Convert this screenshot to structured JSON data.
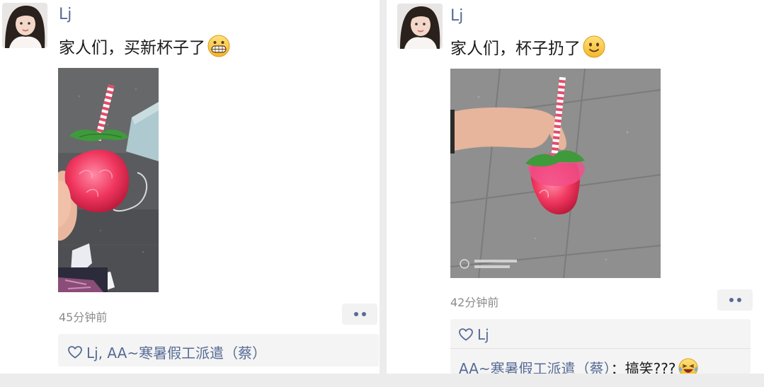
{
  "posts": [
    {
      "author": "Lj",
      "text": "家人们，买新杯子了",
      "emoji_name": "grinning-face-emoji",
      "time": "45分钟前",
      "likes": "Lj, AA~寒暑假工派遣（蔡）"
    },
    {
      "author": "Lj",
      "text": "家人们，杯子扔了",
      "emoji_name": "slight-smile-emoji",
      "time": "42分钟前",
      "likes": "Lj",
      "comment": {
        "author": "AA~寒暑假工派遣（蔡）",
        "separator": "：",
        "text": "搞笑???",
        "emoji_name": "laughing-tears-emoji"
      }
    }
  ],
  "colors": {
    "link": "#576b95",
    "text": "#1a1a1a",
    "time": "#8c8c8c",
    "strawberry": "#e8365b",
    "leaf": "#3a9a3a"
  }
}
